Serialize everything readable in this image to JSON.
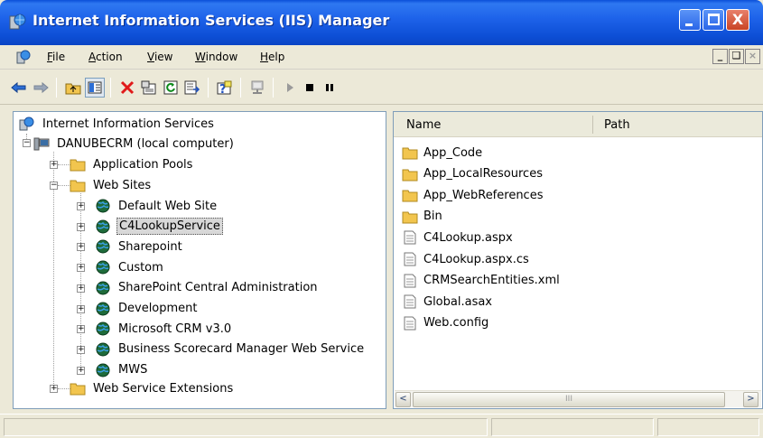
{
  "window": {
    "title": "Internet Information Services (IIS) Manager",
    "close_glyph": "X"
  },
  "menu": {
    "items": [
      "File",
      "Action",
      "View",
      "Window",
      "Help"
    ]
  },
  "mdi_buttons": [
    "_",
    "❑",
    "×"
  ],
  "toolbar": {
    "tools": [
      "back-icon",
      "forward-icon",
      "up-folder-icon",
      "show-hide-tree-icon",
      "delete-icon",
      "properties-icon",
      "refresh-icon",
      "export-list-icon",
      "help-icon",
      "connect-icon",
      "start-icon",
      "stop-icon",
      "pause-icon"
    ]
  },
  "tree": {
    "root": "Internet Information Services",
    "computer": "DANUBECRM (local computer)",
    "app_pools": "Application Pools",
    "web_sites": "Web Sites",
    "sites": [
      "Default Web Site",
      "C4LookupService",
      "Sharepoint",
      "Custom",
      "SharePoint Central Administration",
      "Development",
      "Microsoft CRM v3.0",
      "Business Scorecard Manager Web Service",
      "MWS"
    ],
    "selected_site": "C4LookupService",
    "extensions": "Web Service Extensions"
  },
  "list": {
    "columns": [
      "Name",
      "Path"
    ],
    "items": [
      {
        "name": "App_Code",
        "type": "folder"
      },
      {
        "name": "App_LocalResources",
        "type": "folder"
      },
      {
        "name": "App_WebReferences",
        "type": "folder"
      },
      {
        "name": "Bin",
        "type": "folder"
      },
      {
        "name": "C4Lookup.aspx",
        "type": "file"
      },
      {
        "name": "C4Lookup.aspx.cs",
        "type": "file"
      },
      {
        "name": "CRMSearchEntities.xml",
        "type": "file"
      },
      {
        "name": "Global.asax",
        "type": "file"
      },
      {
        "name": "Web.config",
        "type": "file"
      }
    ],
    "scrollbar": {
      "left_glyph": "<",
      "right_glyph": ">",
      "grip": "III"
    }
  },
  "status": {
    "cells": [
      "",
      "",
      ""
    ]
  },
  "colors": {
    "title_bar": "#1e63ea",
    "close_button": "#c94425",
    "selection": "#d8d8d8",
    "folder": "#f2c54e"
  }
}
